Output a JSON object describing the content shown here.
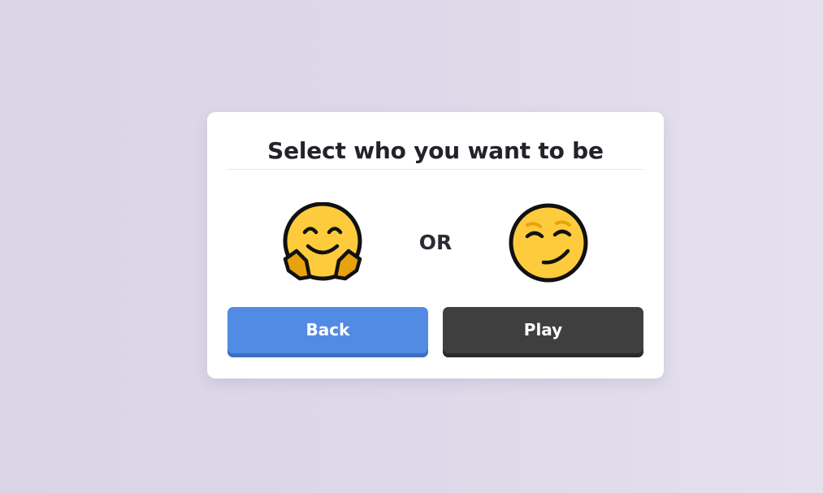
{
  "dialog": {
    "title": "Select who you want to be",
    "or_label": "OR",
    "choices": [
      {
        "icon": "hugging-face-emoji-icon",
        "color": "#fecb3d"
      },
      {
        "icon": "smirking-face-emoji-icon",
        "color": "#fecb3d"
      }
    ],
    "buttons": {
      "back_label": "Back",
      "play_label": "Play"
    }
  },
  "colors": {
    "back_button": "#528be4",
    "play_button": "#3f3f3f",
    "card_background": "#ffffff"
  }
}
